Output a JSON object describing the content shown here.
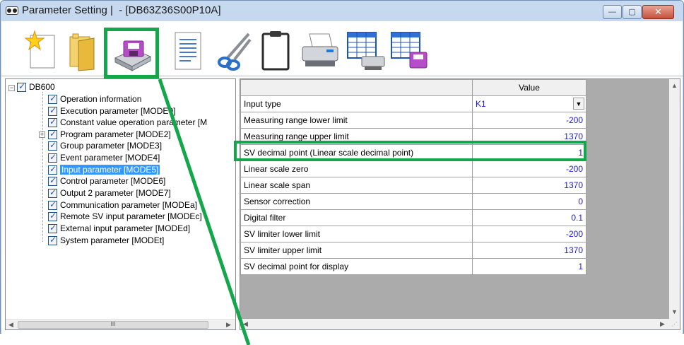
{
  "window": {
    "title": "Parameter Setting |  - [DB63Z36S00P10A]",
    "buttons": {
      "minimize": "—",
      "maximize": "▢",
      "close": "✕"
    }
  },
  "toolbar": {
    "buttons": [
      {
        "name": "new-button",
        "icon": "new-document-icon"
      },
      {
        "name": "open-button",
        "icon": "folder-icon"
      },
      {
        "name": "save-button",
        "icon": "disk-icon"
      },
      {
        "name": "file-info-button",
        "icon": "text-document-icon"
      },
      {
        "name": "cut-button",
        "icon": "scissors-icon"
      },
      {
        "name": "paste-button",
        "icon": "clipboard-icon"
      },
      {
        "name": "print-button",
        "icon": "printer-icon"
      },
      {
        "name": "print-table-button",
        "icon": "table-printer-icon"
      },
      {
        "name": "save-table-button",
        "icon": "table-disk-icon"
      }
    ]
  },
  "tree": {
    "root": "DB600",
    "items": [
      "Operation information",
      "Execution parameter [MODE0]",
      "Constant value operation parameter [M",
      "Program parameter [MODE2]",
      "Group parameter [MODE3]",
      "Event parameter [MODE4]",
      "Input parameter [MODE5]",
      "Control parameter [MODE6]",
      "Output 2 parameter [MODE7]",
      "Communication parameter [MODEa]",
      "Remote SV input parameter [MODEc]",
      "External input parameter [MODEd]",
      "System parameter [MODEt]"
    ],
    "selected_index": 6,
    "scroll_thumb": "III"
  },
  "grid": {
    "header": "Value",
    "rows": [
      {
        "label": "Input type",
        "value": "K1"
      },
      {
        "label": "Measuring range lower limit",
        "value": "-200"
      },
      {
        "label": "Measuring range upper limit",
        "value": "1370"
      },
      {
        "label": "SV decimal point (Linear scale decimal point)",
        "value": "1"
      },
      {
        "label": "Linear scale zero",
        "value": "-200"
      },
      {
        "label": "Linear scale span",
        "value": "1370"
      },
      {
        "label": "Sensor correction",
        "value": "0"
      },
      {
        "label": "Digital filter",
        "value": "0.1"
      },
      {
        "label": "SV limiter lower limit",
        "value": "-200"
      },
      {
        "label": "SV limiter upper limit",
        "value": "1370"
      },
      {
        "label": "SV decimal point for display",
        "value": "1"
      }
    ]
  },
  "colors": {
    "highlight": "#14a64a",
    "selection": "#3399ff",
    "value_text": "#1b1bd6"
  }
}
